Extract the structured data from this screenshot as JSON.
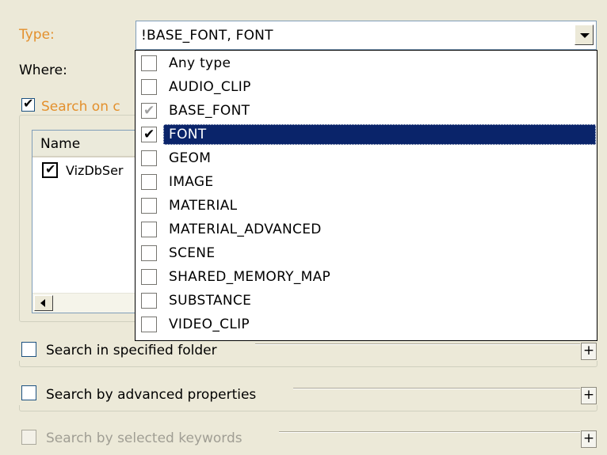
{
  "type_label": "Type:",
  "type_value": "!BASE_FONT, FONT",
  "where_label": "Where:",
  "search_on": {
    "label": "Search on c",
    "checked": true
  },
  "list": {
    "column_name": "Name",
    "rows": [
      {
        "label": "VizDbSer",
        "checked": true
      }
    ]
  },
  "dropdown_items": [
    {
      "label": "Any type",
      "checked": false
    },
    {
      "label": "AUDIO_CLIP",
      "checked": false
    },
    {
      "label": "BASE_FONT",
      "checked": true,
      "grayed": true
    },
    {
      "label": "FONT",
      "checked": true,
      "selected": true
    },
    {
      "label": "GEOM",
      "checked": false
    },
    {
      "label": "IMAGE",
      "checked": false
    },
    {
      "label": "MATERIAL",
      "checked": false
    },
    {
      "label": "MATERIAL_ADVANCED",
      "checked": false
    },
    {
      "label": "SCENE",
      "checked": false
    },
    {
      "label": "SHARED_MEMORY_MAP",
      "checked": false
    },
    {
      "label": "SUBSTANCE",
      "checked": false
    },
    {
      "label": "VIDEO_CLIP",
      "checked": false
    }
  ],
  "sections": {
    "folder": {
      "label": "Search in specified folder",
      "checked": false,
      "expand": "+"
    },
    "advanced": {
      "label": "Search by advanced properties",
      "checked": false,
      "expand": "+"
    },
    "keywords": {
      "label": "Search by selected keywords",
      "checked": false,
      "disabled": true,
      "expand": "+"
    }
  },
  "colors": {
    "accent_label": "#e3902d",
    "selection": "#0a246a",
    "window_bg": "#ece9d8"
  }
}
